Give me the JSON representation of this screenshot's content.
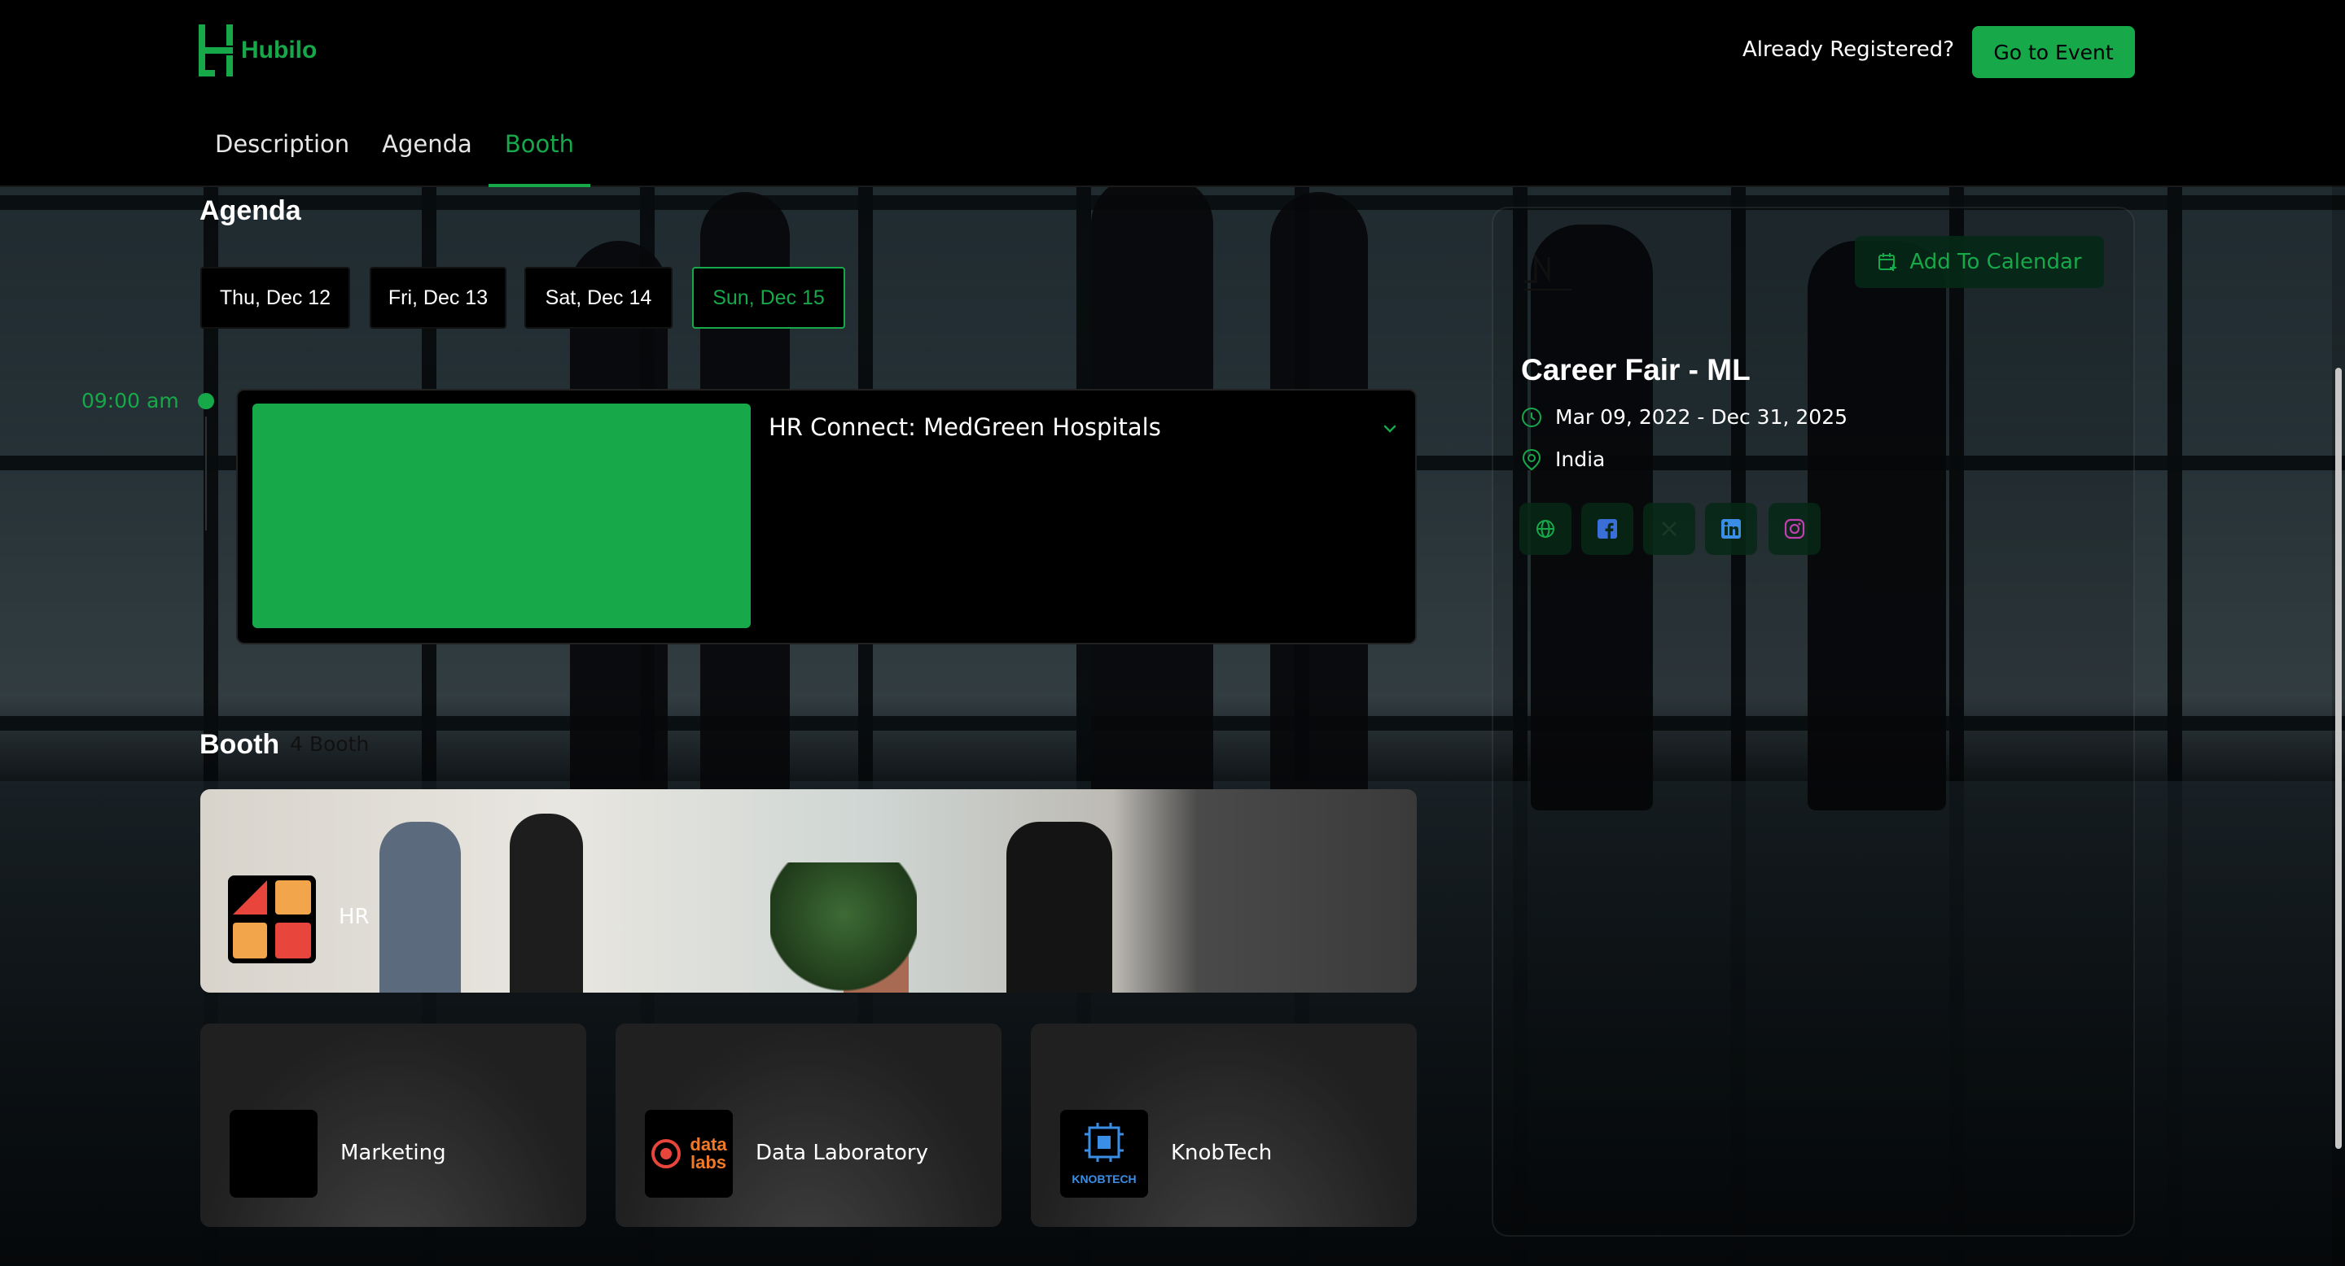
{
  "header": {
    "brand": "Hubilo",
    "already_registered": "Already Registered?",
    "go_to_event": "Go to Event"
  },
  "tabs": [
    {
      "label": "Description",
      "active": false
    },
    {
      "label": "Agenda",
      "active": false
    },
    {
      "label": "Booth",
      "active": true
    }
  ],
  "agenda": {
    "title": "Agenda",
    "days": [
      {
        "label": "Thu, Dec 12",
        "active": false
      },
      {
        "label": "Fri, Dec 13",
        "active": false
      },
      {
        "label": "Sat, Dec 14",
        "active": false
      },
      {
        "label": "Sun, Dec 15",
        "active": true
      }
    ],
    "sessions": [
      {
        "time": "09:00 am",
        "title": "HR Connect: MedGreen Hospitals"
      }
    ]
  },
  "booth": {
    "title": "Booth",
    "count": "4 Booth",
    "items": [
      {
        "name": "HR",
        "logo": "hr-logo-icon"
      },
      {
        "name": "Marketing",
        "logo": "marketing-logo"
      },
      {
        "name": "Data Laboratory",
        "logo": "data-labs-logo",
        "logo_text": "data\nlabs"
      },
      {
        "name": "KnobTech",
        "logo": "knobtech-logo",
        "logo_text": "KNOBTECH"
      }
    ]
  },
  "event": {
    "add_to_calendar": "Add To Calendar",
    "title": "Career Fair - ML",
    "date_range": "Mar 09, 2022 - Dec 31, 2025",
    "location": "India",
    "socials": [
      "globe-icon",
      "facebook-icon",
      "x-icon",
      "linkedin-icon",
      "instagram-icon"
    ]
  },
  "colors": {
    "accent": "#17a84a",
    "background": "#000000"
  }
}
